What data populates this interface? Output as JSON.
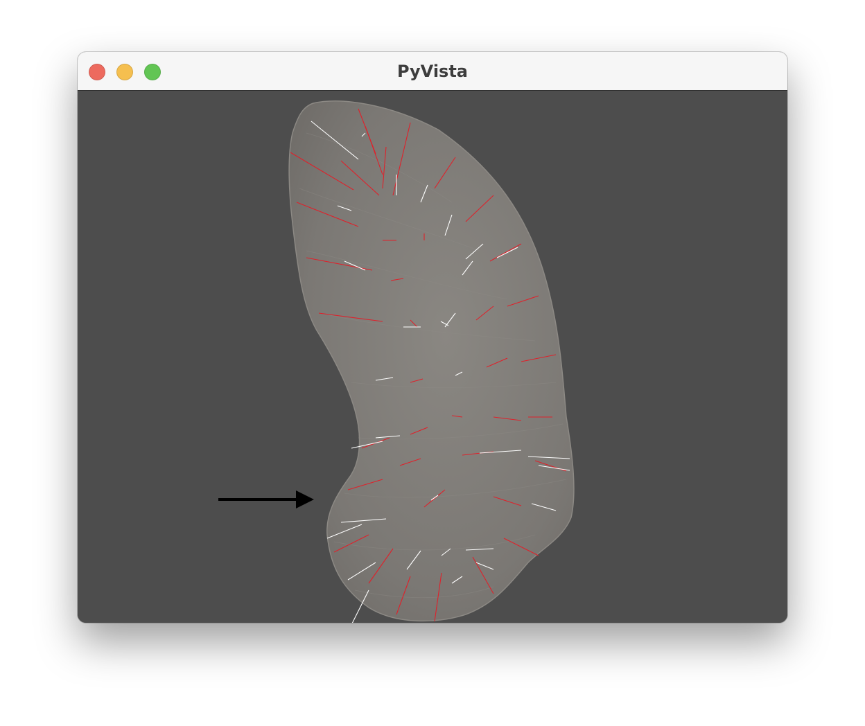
{
  "window": {
    "title": "PyVista",
    "buttons": [
      {
        "name": "close",
        "color": "#ed6a5e"
      },
      {
        "name": "minimize",
        "color": "#f5bf4f"
      },
      {
        "name": "zoom",
        "color": "#62c554"
      }
    ]
  },
  "viewport": {
    "background_color": "#4d4d4d",
    "mesh_color": "#7d7a76",
    "mesh_opacity": 0.9,
    "vector_colors": {
      "primary": "#e0202a",
      "secondary": "#ffffff"
    },
    "annotation_arrow_color": "#000000"
  }
}
